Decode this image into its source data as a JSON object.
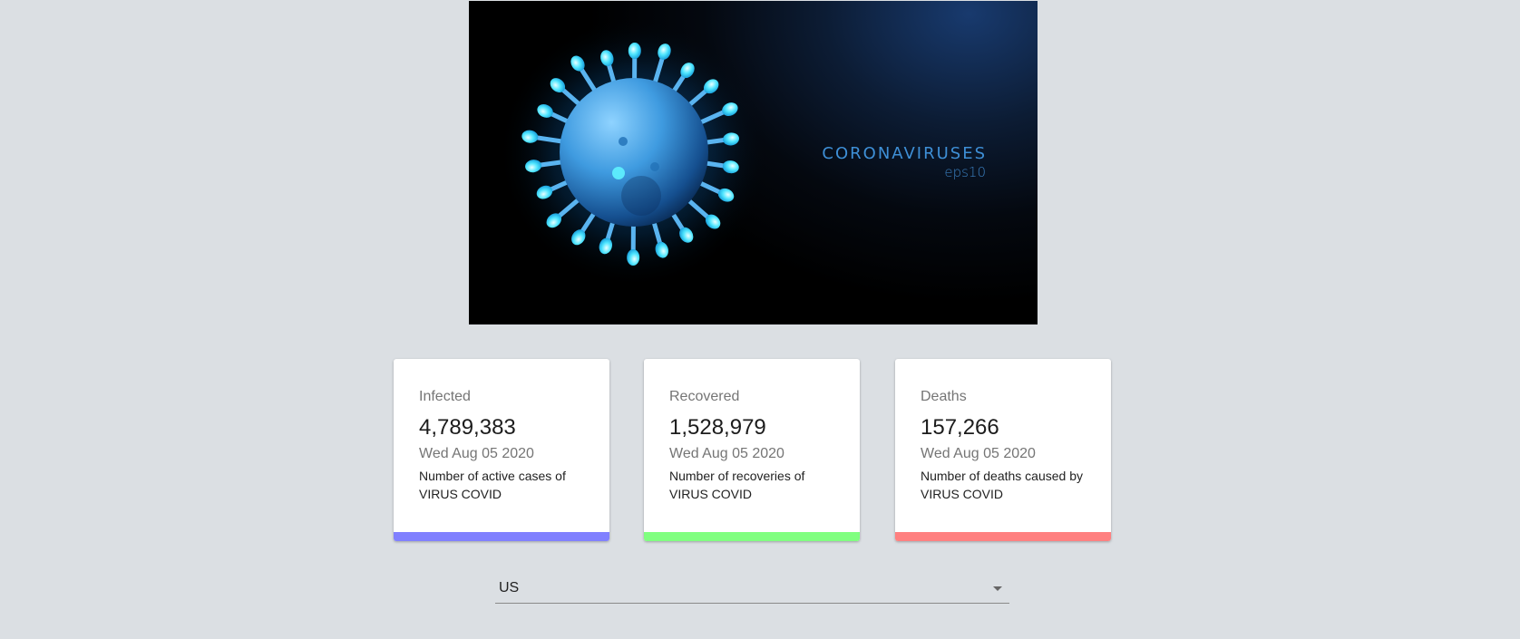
{
  "banner": {
    "title": "CORONAVIRUSES",
    "subtitle": "eps10",
    "icon": "coronavirus-illustration"
  },
  "cards": [
    {
      "label": "Infected",
      "value": "4,789,383",
      "date": "Wed Aug 05 2020",
      "description": "Number of active cases of VIRUS COVID",
      "color": "#8080ff"
    },
    {
      "label": "Recovered",
      "value": "1,528,979",
      "date": "Wed Aug 05 2020",
      "description": "Number of recoveries of VIRUS COVID",
      "color": "#80ff80"
    },
    {
      "label": "Deaths",
      "value": "157,266",
      "date": "Wed Aug 05 2020",
      "description": "Number of deaths caused by VIRUS COVID",
      "color": "#ff8080"
    }
  ],
  "country_select": {
    "value": "US",
    "icon": "caret-down-icon"
  }
}
